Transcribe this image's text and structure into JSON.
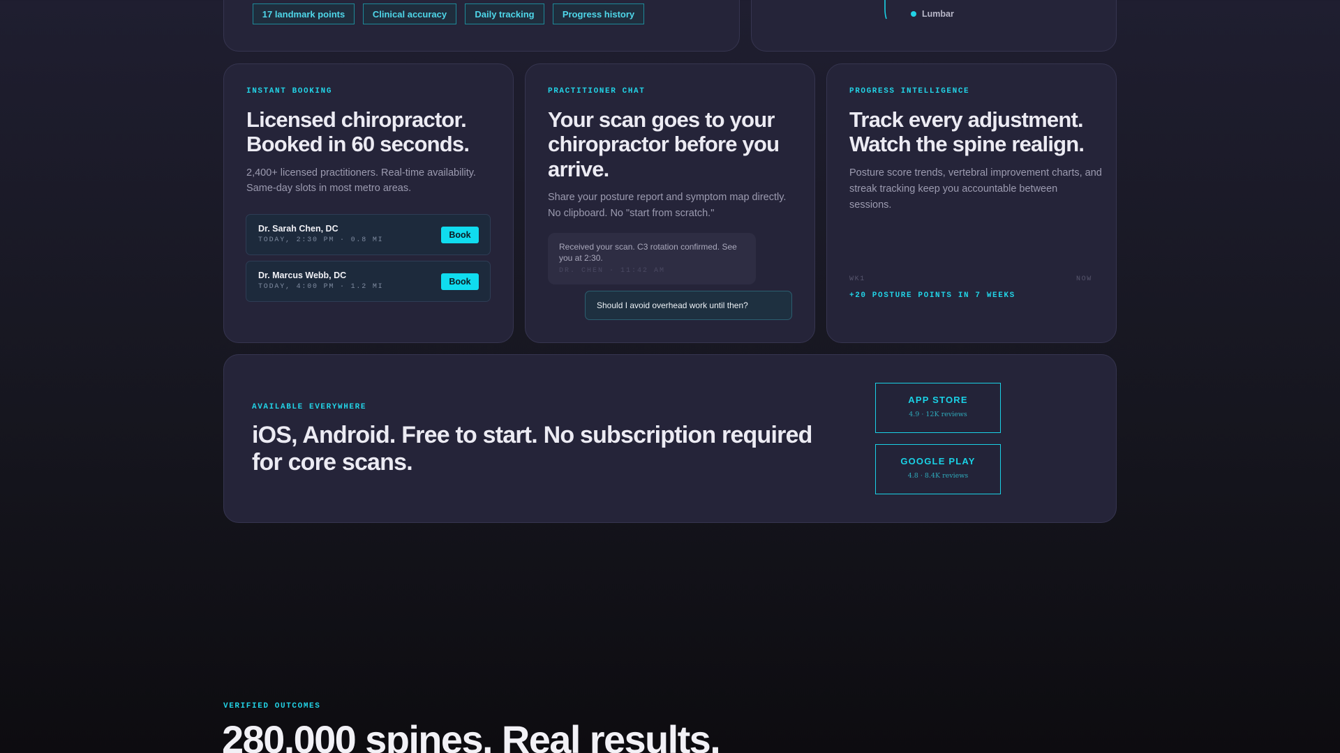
{
  "features_card": {
    "chips": [
      "17 landmark points",
      "Clinical accuracy",
      "Daily tracking",
      "Progress history"
    ]
  },
  "spine_card": {
    "legend_label": "Lumbar"
  },
  "booking": {
    "eyebrow": "INSTANT BOOKING",
    "headline_line1": "Licensed chiropractor.",
    "headline_line2": "Booked in 60 seconds.",
    "body_line1": "2,400+ licensed practitioners. Real-time availability.",
    "body_line2": "Same-day slots in most metro areas.",
    "practitioners": [
      {
        "name": "Dr. Sarah Chen, DC",
        "meta": "TODAY, 2:30 PM · 0.8 MI",
        "button": "Book"
      },
      {
        "name": "Dr. Marcus Webb, DC",
        "meta": "TODAY, 4:00 PM · 1.2 MI",
        "button": "Book"
      }
    ]
  },
  "chat": {
    "eyebrow": "PRACTITIONER CHAT",
    "headline_line1": "Your scan goes to your",
    "headline_line2": "chiropractor before you",
    "headline_line3": "arrive.",
    "body_line1": "Share your posture report and symptom map directly.",
    "body_line2": "No clipboard. No \"start from scratch.\"",
    "incoming_message": "Received your scan. C3 rotation confirmed. See you at 2:30.",
    "incoming_stamp": "DR. CHEN · 11:42 AM",
    "outgoing_message": "Should I avoid overhead work until then?"
  },
  "progress": {
    "eyebrow": "PROGRESS INTELLIGENCE",
    "headline_line1": "Track every adjustment.",
    "headline_line2": "Watch the spine realign.",
    "body_line1": "Posture score trends, vertebral improvement charts, and",
    "body_line2": "streak tracking keep you accountable between",
    "body_line3": "sessions.",
    "axis_start": "WK1",
    "axis_end": "NOW",
    "summary": "+20 POSTURE POINTS IN 7 WEEKS"
  },
  "availability": {
    "eyebrow": "AVAILABLE EVERYWHERE",
    "headline_line1": "iOS, Android. Free to start. No subscription required",
    "headline_line2": "for core scans.",
    "stores": [
      {
        "name": "APP STORE",
        "rating": "4.9 · 12K reviews"
      },
      {
        "name": "GOOGLE PLAY",
        "rating": "4.8 · 8.4K reviews"
      }
    ]
  },
  "outcomes": {
    "eyebrow": "VERIFIED OUTCOMES",
    "headline": "280,000 spines. Real results."
  },
  "colors": {
    "accent": "#22d3e6",
    "card": "#252439",
    "background": "#1f1e30"
  }
}
